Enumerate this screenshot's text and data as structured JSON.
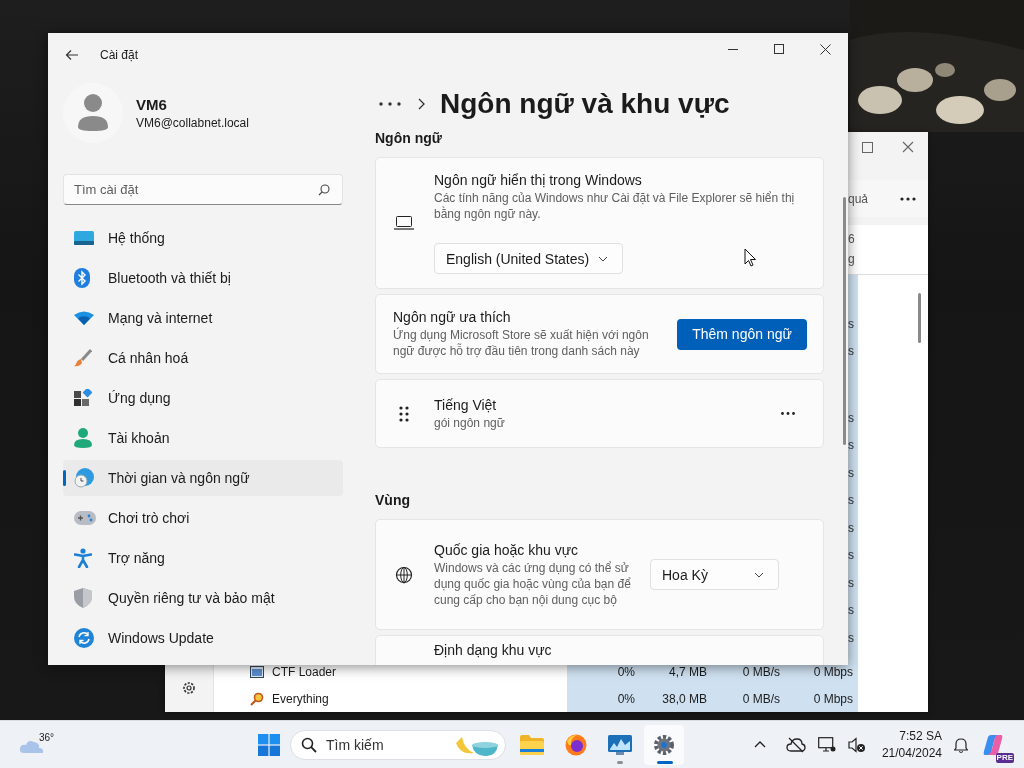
{
  "task_manager": {
    "toolbar_text": "quả",
    "header_fragments": [
      "6",
      "g"
    ],
    "column_fragments": [
      "s",
      "s",
      "s",
      "s",
      "s",
      "s",
      "s",
      "s",
      "s",
      "s",
      "s"
    ],
    "rows": [
      {
        "name": "CTF Loader",
        "cpu": "0%",
        "memory": "4,7 MB",
        "disk": "0 MB/s",
        "network": "0 Mbps"
      },
      {
        "name": "Everything",
        "cpu": "0%",
        "memory": "38,0 MB",
        "disk": "0 MB/s",
        "network": "0 Mbps"
      }
    ]
  },
  "settings_window": {
    "title": "Cài đặt",
    "user": {
      "name": "VM6",
      "email": "VM6@collabnet.local"
    },
    "search": {
      "placeholder": "Tìm cài đặt"
    },
    "nav_items": [
      {
        "label": "Hệ thống",
        "selected": false
      },
      {
        "label": "Bluetooth và thiết bị",
        "selected": false
      },
      {
        "label": "Mạng và internet",
        "selected": false
      },
      {
        "label": "Cá nhân hoá",
        "selected": false
      },
      {
        "label": "Ứng dụng",
        "selected": false
      },
      {
        "label": "Tài khoản",
        "selected": false
      },
      {
        "label": "Thời gian và ngôn ngữ",
        "selected": true
      },
      {
        "label": "Chơi trò chơi",
        "selected": false
      },
      {
        "label": "Trợ năng",
        "selected": false
      },
      {
        "label": "Quyền riêng tư và bảo mật",
        "selected": false
      },
      {
        "label": "Windows Update",
        "selected": false
      }
    ],
    "page_title": "Ngôn ngữ và khu vực",
    "sections": [
      {
        "heading": "Ngôn ngữ",
        "cards": [
          {
            "kind": "display",
            "title": "Ngôn ngữ hiển thị trong Windows",
            "description": "Các tính năng của Windows như Cài đặt và File Explorer sẽ hiển thị bằng ngôn ngữ này.",
            "dropdown": "English (United States)"
          },
          {
            "kind": "preferred",
            "title": "Ngôn ngữ ưa thích",
            "description": "Ứng dụng Microsoft Store sẽ xuất hiện với ngôn ngữ được hỗ trợ đầu tiên trong danh sách này",
            "button": "Thêm ngôn ngữ"
          },
          {
            "kind": "language",
            "title": "Tiếng Việt",
            "description": "gói ngôn ngữ"
          }
        ]
      },
      {
        "heading": "Vùng",
        "cards": [
          {
            "kind": "region",
            "title": "Quốc gia hoặc khu vực",
            "description": "Windows và các ứng dụng có thể sử dụng quốc gia hoặc vùng của bạn để cung cấp cho bạn nội dung cục bộ",
            "dropdown": "Hoa Kỳ"
          },
          {
            "kind": "format",
            "title": "Định dạng khu vực"
          }
        ]
      }
    ]
  },
  "taskbar": {
    "weather": "36°",
    "search": {
      "placeholder": "Tìm kiếm"
    },
    "apps": [
      {
        "running": false,
        "selected": false
      },
      {
        "running": false,
        "selected": false
      },
      {
        "running": true,
        "selected": false
      },
      {
        "running": true,
        "selected": true
      }
    ],
    "clock": {
      "time": "7:52 SA",
      "date": "21/04/2024"
    },
    "copilot_badge": "PRE"
  }
}
